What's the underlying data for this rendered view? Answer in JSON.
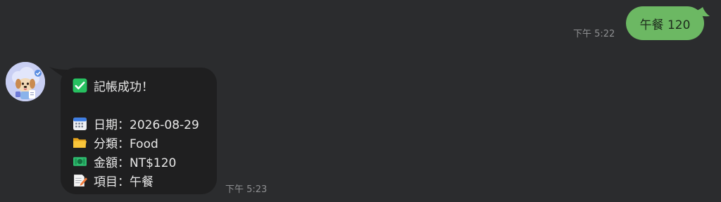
{
  "outgoing": {
    "text": "午餐 120",
    "time": "下午 5:22",
    "bubble_color": "#6cb863"
  },
  "incoming": {
    "avatar": "dog-mascot-avatar",
    "time": "下午 5:23",
    "bubble_color": "#1f1f20",
    "lines": [
      {
        "icon": "check-mark-icon",
        "text": "記帳成功！"
      },
      {
        "icon": "calendar-icon",
        "text": "日期：2026-08-29"
      },
      {
        "icon": "folder-icon",
        "text": "分類：Food"
      },
      {
        "icon": "money-icon",
        "text": "金額：NT$120"
      },
      {
        "icon": "memo-icon",
        "text": "項目：午餐"
      }
    ]
  }
}
